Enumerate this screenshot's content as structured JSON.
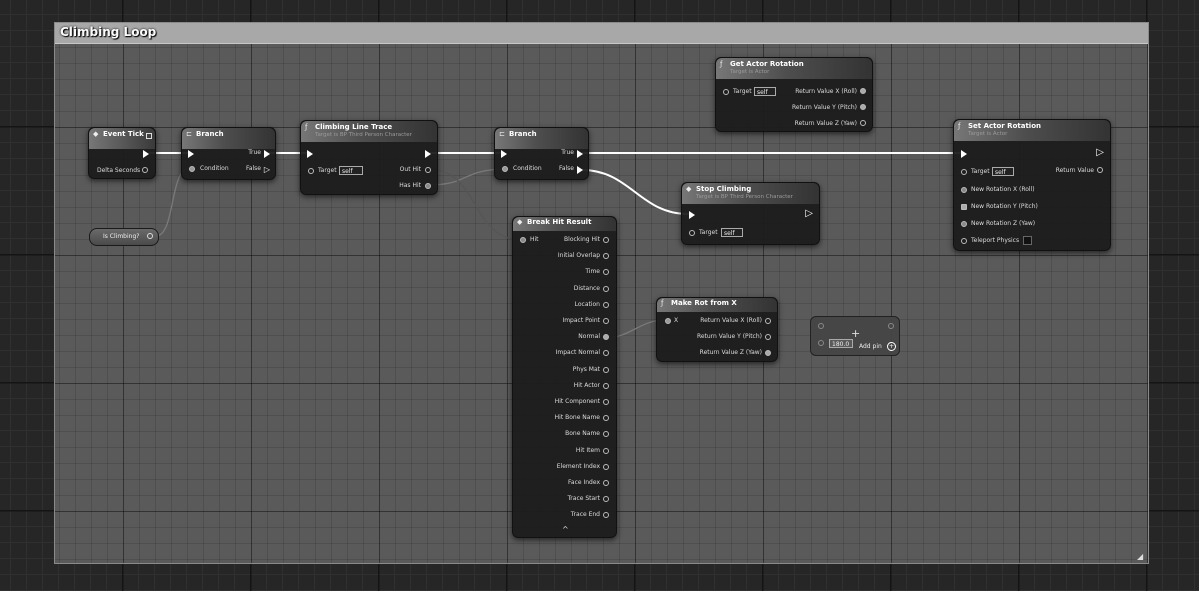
{
  "comment": {
    "title": "Climbing Loop"
  },
  "nodes": {
    "event_tick": {
      "title": "Event Tick",
      "pin_delta": "Delta Seconds"
    },
    "branch1": {
      "title": "Branch",
      "condition": "Condition",
      "true_label": "True",
      "false_label": "False"
    },
    "line_trace": {
      "title": "Climbing Line Trace",
      "subtitle": "Target is BP Third Person Character",
      "target": "Target",
      "self": "self",
      "out_hit": "Out Hit",
      "has_hit": "Has Hit"
    },
    "branch2": {
      "title": "Branch",
      "condition": "Condition",
      "true_label": "True",
      "false_label": "False"
    },
    "get_actor_rotation": {
      "title": "Get Actor Rotation",
      "subtitle": "Target is Actor",
      "target": "Target",
      "self": "self",
      "rv_x": "Return Value X (Roll)",
      "rv_y": "Return Value Y (Pitch)",
      "rv_z": "Return Value Z (Yaw)"
    },
    "set_actor_rotation": {
      "title": "Set Actor Rotation",
      "subtitle": "Target is Actor",
      "target": "Target",
      "self": "self",
      "return_value": "Return Value",
      "new_x": "New Rotation X (Roll)",
      "new_y": "New Rotation Y (Pitch)",
      "new_z": "New Rotation Z (Yaw)",
      "teleport": "Teleport Physics"
    },
    "stop_climbing": {
      "title": "Stop Climbing",
      "subtitle": "Target is BP Third Person Character",
      "target": "Target",
      "self": "self"
    },
    "is_climbing": {
      "title": "Is Climbing?"
    },
    "break_hit": {
      "title": "Break Hit Result",
      "hit": "Hit",
      "outputs": [
        "Blocking Hit",
        "Initial Overlap",
        "Time",
        "Distance",
        "Location",
        "Impact Point",
        "Normal",
        "Impact Normal",
        "Phys Mat",
        "Hit Actor",
        "Hit Component",
        "Hit Bone Name",
        "Bone Name",
        "Hit Item",
        "Element Index",
        "Face Index",
        "Trace Start",
        "Trace End"
      ],
      "expand": "^"
    },
    "make_rot": {
      "title": "Make Rot from X",
      "x": "X",
      "rv_x": "Return Value X (Roll)",
      "rv_y": "Return Value Y (Pitch)",
      "rv_z": "Return Value Z (Yaw)"
    },
    "math_node": {
      "value": "180.0",
      "add_pin": "Add pin",
      "operator": "+"
    }
  },
  "colors": {
    "exec": "#ffffff",
    "wire_data": "#8a8a8a",
    "header": "#777777"
  }
}
